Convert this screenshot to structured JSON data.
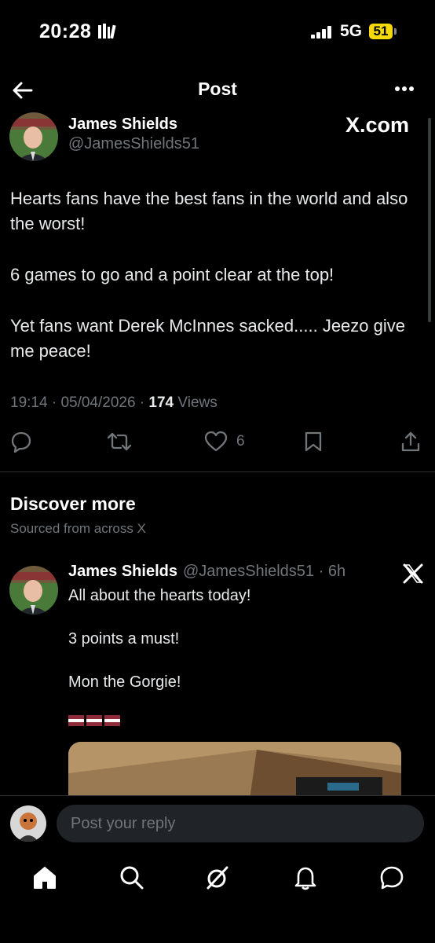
{
  "status_bar": {
    "time": "20:28",
    "network": "5G",
    "battery": "51"
  },
  "header": {
    "title": "Post"
  },
  "post": {
    "author_name": "James Shields",
    "author_handle": "@JamesShields51",
    "badge": "X.com",
    "paragraphs": [
      "Hearts fans have the best fans in the world and also the worst!",
      "6 games to go and a point clear at the top!",
      "Yet fans want Derek McInnes sacked..... Jeezo give me peace!"
    ],
    "time": "19:14",
    "date": "05/04/2026",
    "views_count": "174",
    "views_label": "Views",
    "likes": "6"
  },
  "discover": {
    "title": "Discover more",
    "subtitle": "Sourced from across X",
    "post": {
      "author_name": "James Shields",
      "author_handle": "@JamesShields51",
      "age": "6h",
      "paragraphs": [
        "All about the hearts today!",
        "3 points a must!",
        "Mon the Gorgie!"
      ]
    }
  },
  "reply": {
    "placeholder": "Post your reply"
  },
  "colors": {
    "background": "#000000",
    "muted": "#71767b",
    "battery": "#f5d90a",
    "flag_maroon": "#8e2a3a"
  }
}
